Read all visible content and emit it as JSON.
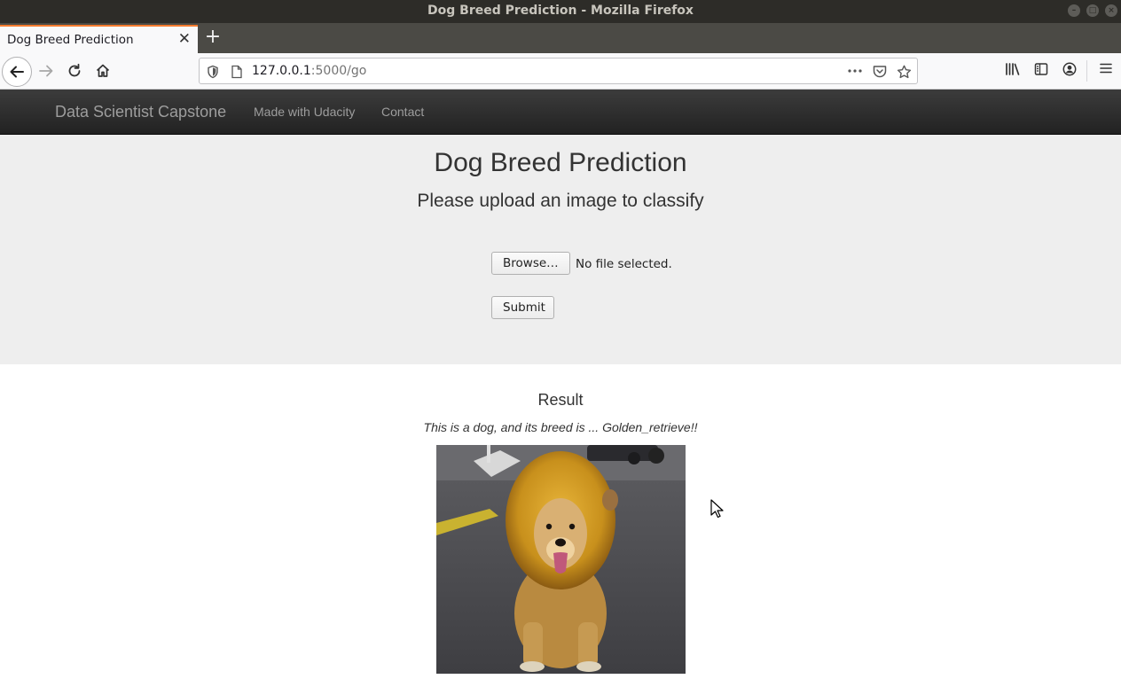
{
  "window": {
    "title": "Dog Breed Prediction - Mozilla Firefox"
  },
  "browser": {
    "tab_title": "Dog Breed Prediction",
    "url_host": "127.0.0.1",
    "url_rest": ":5000/go"
  },
  "site_nav": {
    "brand": "Data Scientist Capstone",
    "links": [
      "Made with Udacity",
      "Contact"
    ]
  },
  "jumbotron": {
    "title": "Dog Breed Prediction",
    "subtitle": "Please upload an image to classify",
    "browse_label": "Browse…",
    "file_status": "No file selected.",
    "submit_label": "Submit"
  },
  "result": {
    "heading": "Result",
    "text": "This is a dog, and its breed is ... Golden_retrieve!!"
  }
}
